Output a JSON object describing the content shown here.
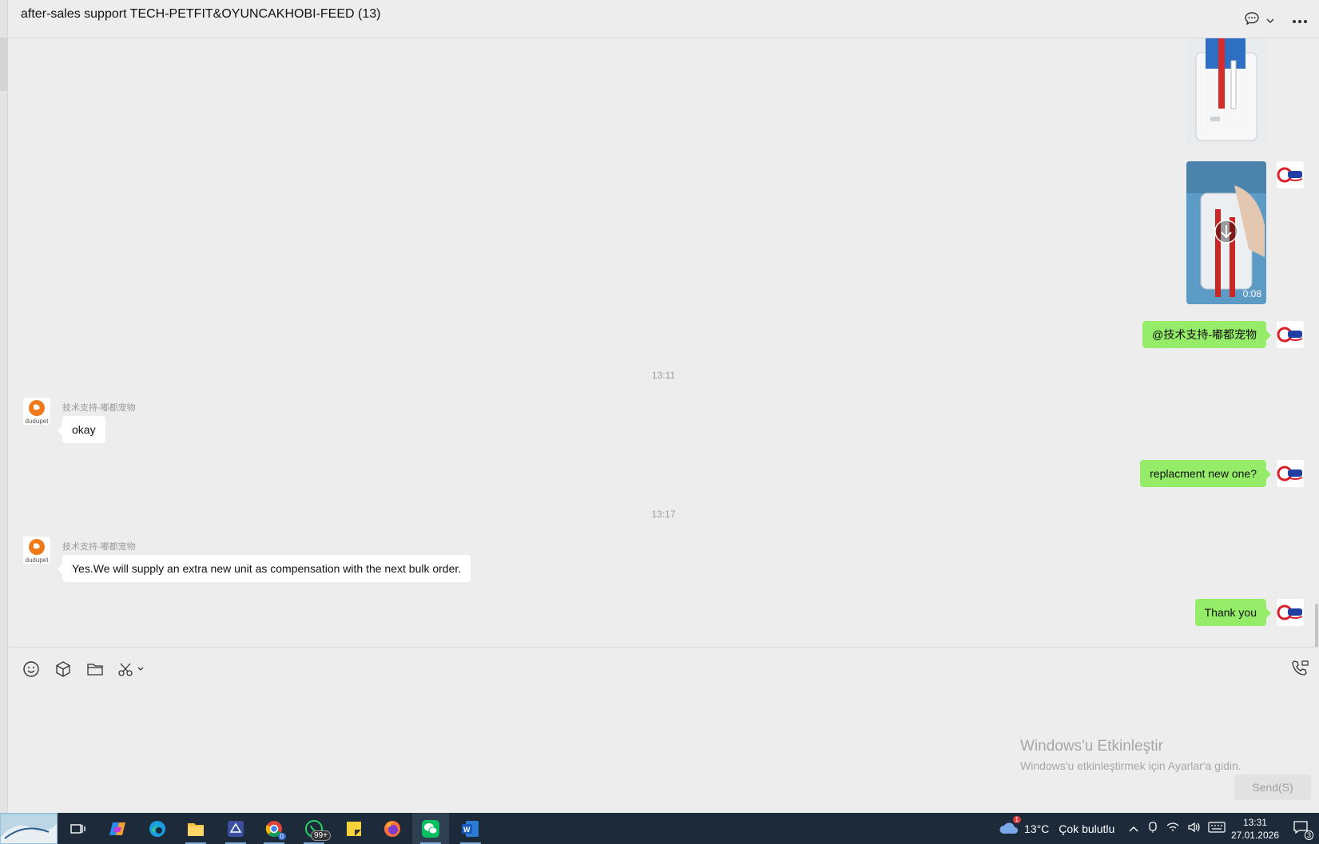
{
  "header": {
    "title": "after-sales support TECH-PETFIT&OYUNCAKHOBI-FEED (13)"
  },
  "messages": {
    "video_duration": "0:08",
    "mention_text": "@技术支持-嘟都宠物",
    "time_1": "13:11",
    "sender_name_1": "技术支持-嘟都宠物",
    "reply_okay": "okay",
    "question_text": "replacment new one?",
    "time_2": "13:17",
    "sender_name_2": "技术支持-嘟都宠物",
    "reply_compensation": "Yes.We will supply an extra new unit as compensation with the next bulk order.",
    "thanks_text": "Thank you",
    "avatar_in_label": "dudupet"
  },
  "input": {
    "send_label": "Send(S)"
  },
  "watermark": {
    "title": "Windows'u Etkinleştir",
    "subtitle": "Windows'u etkinleştirmek için Ayarlar'a gidin."
  },
  "taskbar": {
    "whatsapp_badge": "99+",
    "chrome_badge": "0",
    "weather_badge": "1",
    "weather_temp": "13°C",
    "weather_desc": "Çok bulutlu",
    "time": "13:31",
    "date": "27.01.2026",
    "notification_count": "3"
  },
  "colors": {
    "outgoing_bubble": "#95ec69",
    "incoming_bubble": "#ffffff",
    "background": "#ededed",
    "taskbar": "#1c2a3a"
  }
}
